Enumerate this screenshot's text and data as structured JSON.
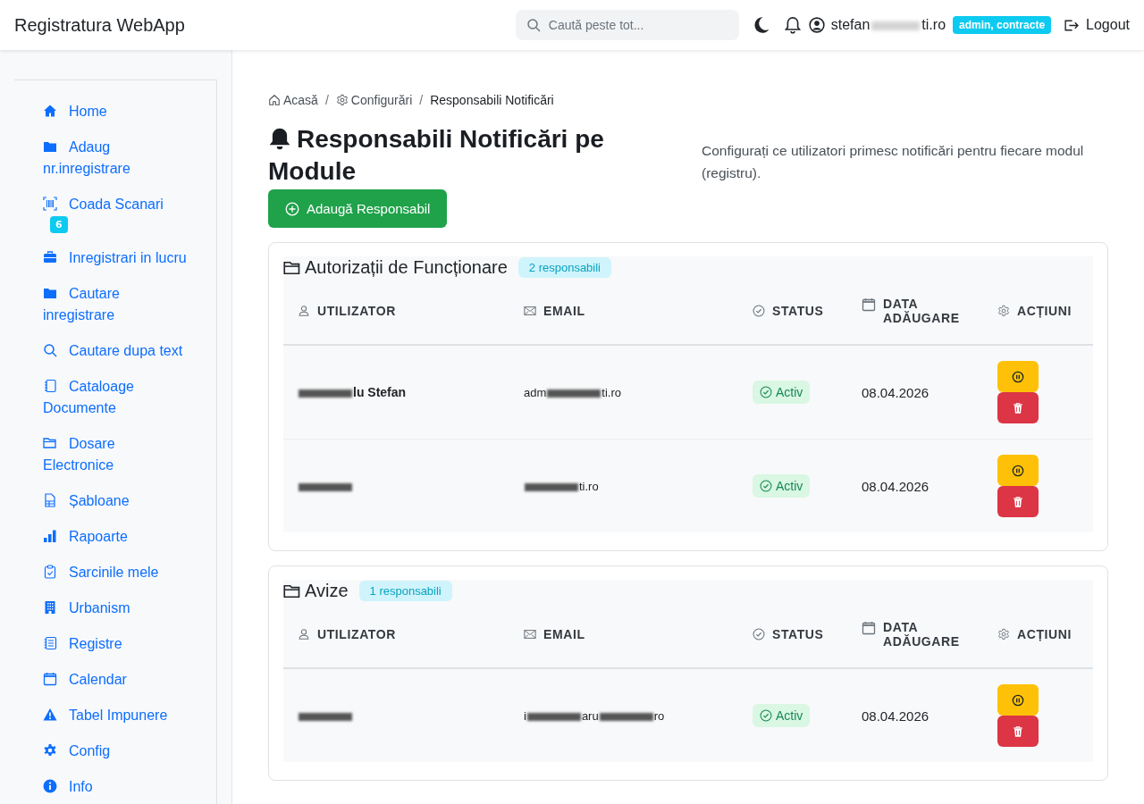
{
  "topbar": {
    "brand": "Registratura WebApp",
    "search": {
      "placeholder": "Caută peste tot..."
    },
    "user": [
      {
        "kind": "text",
        "text": "stefan"
      },
      {
        "kind": "redacted"
      },
      {
        "kind": "text",
        "text": "ti.ro"
      }
    ],
    "role_badge": "admin, contracte",
    "logout": "Logout"
  },
  "sidebar": {
    "items": [
      {
        "label": "Home"
      },
      {
        "label": "Adaug nr.inregistrare"
      },
      {
        "label": "Coada Scanari",
        "badge": "6"
      },
      {
        "label": "Inregistrari in lucru"
      },
      {
        "label": "Cautare inregistrare"
      },
      {
        "label": "Cautare dupa text"
      },
      {
        "label": "Cataloage Documente"
      },
      {
        "label": "Dosare Electronice"
      },
      {
        "label": "Șabloane"
      },
      {
        "label": "Rapoarte"
      },
      {
        "label": "Sarcinile mele"
      },
      {
        "label": "Urbanism"
      },
      {
        "label": "Registre"
      },
      {
        "label": "Calendar"
      },
      {
        "label": "Tabel Impunere"
      },
      {
        "label": "Config"
      },
      {
        "label": "Info"
      }
    ]
  },
  "breadcrumb": [
    {
      "label": "Acasă",
      "current": false
    },
    {
      "separator_before": "/",
      "label": "Configurări",
      "current": false
    },
    {
      "separator_before": "/",
      "label": "Responsabili Notificări",
      "current": true
    }
  ],
  "heading": "Responsabili Notificări pe Module",
  "description": "Configurați ce utilizatori primesc notificări pentru fiecare modul (registru).",
  "add_button": "Adaugă Responsabil",
  "modules": [
    {
      "title": "Autorizații de Funcționare",
      "count": "2 responsabili",
      "columns": [
        "UTILIZATOR",
        "EMAIL",
        "STATUS",
        "DATA ADĂUGARE",
        "ACȚIUNI"
      ],
      "rows": [
        {
          "user": [
            {
              "kind": "redacted"
            },
            {
              "kind": "text",
              "text": "lu Stefan"
            }
          ],
          "email": [
            {
              "kind": "text",
              "text": "adm"
            },
            {
              "kind": "redacted"
            },
            {
              "kind": "text",
              "text": "ti.ro"
            }
          ],
          "status": {
            "kind": "active",
            "text": "Activ"
          },
          "date": "08.04.2026"
        },
        {
          "user": [
            {
              "kind": "redacted"
            }
          ],
          "email": [
            {
              "kind": "redacted"
            },
            {
              "kind": "text",
              "text": "ti.ro"
            }
          ],
          "status": {
            "kind": "active",
            "text": "Activ"
          },
          "date": "08.04.2026"
        }
      ]
    },
    {
      "title": "Avize",
      "count": "1 responsabili",
      "columns": [
        "UTILIZATOR",
        "EMAIL",
        "STATUS",
        "DATA ADĂUGARE",
        "ACȚIUNI"
      ],
      "rows": [
        {
          "user": [
            {
              "kind": "redacted"
            }
          ],
          "email": [
            {
              "kind": "text",
              "text": "i"
            },
            {
              "kind": "redacted"
            },
            {
              "kind": "text",
              "text": "aru"
            },
            {
              "kind": "redacted"
            },
            {
              "kind": "text",
              "text": "ro"
            }
          ],
          "status": {
            "kind": "active",
            "text": "Activ"
          },
          "date": "08.04.2026"
        }
      ]
    }
  ]
}
